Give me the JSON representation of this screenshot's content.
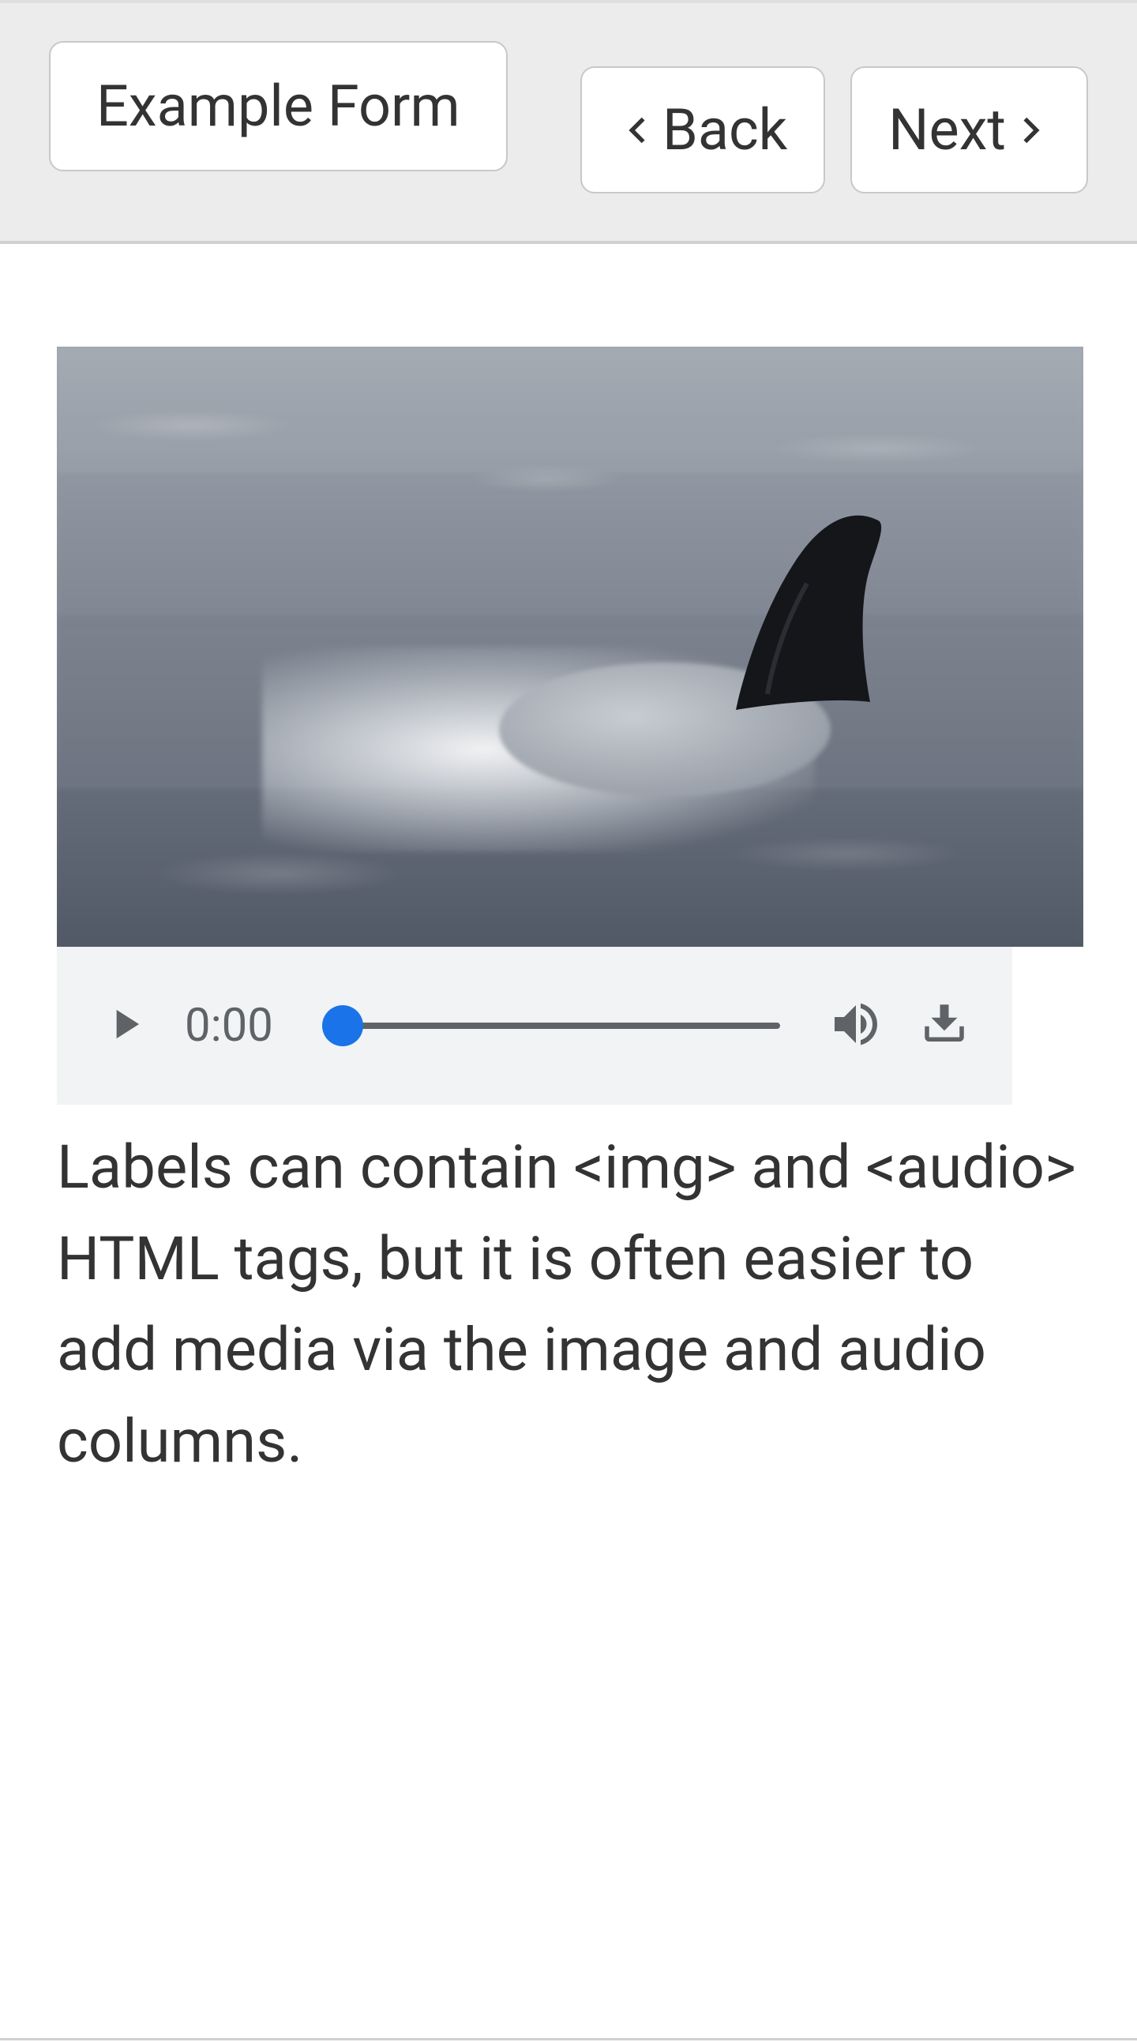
{
  "header": {
    "title": "Example Form",
    "back_label": "Back",
    "next_label": "Next"
  },
  "media": {
    "image_alt": "dolphin-fin-ocean"
  },
  "audio": {
    "current_time": "0:00"
  },
  "label_text": "Labels can contain <img> and <audio> HTML tags, but it is often easier to add media via the image and audio columns."
}
